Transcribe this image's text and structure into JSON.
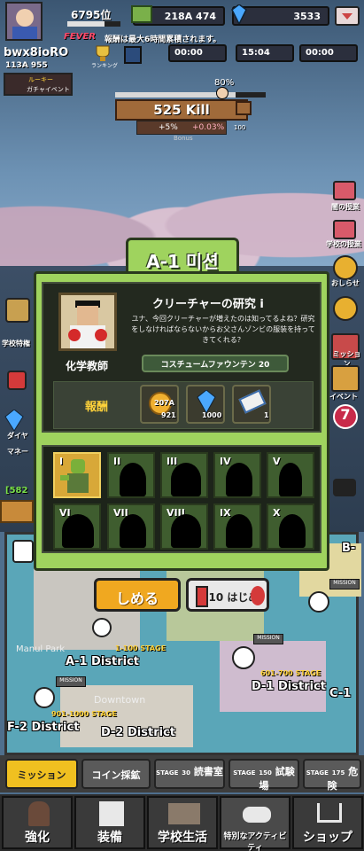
{
  "player": {
    "rank": "6795位",
    "name": "bwx8ioRO",
    "power": "113A 955",
    "banner_line1": "ルーキー",
    "banner_line2": "ガチャイベント"
  },
  "resources": {
    "cash": "218A 474",
    "gems": "3533"
  },
  "fever": {
    "label": "FEVER",
    "notice": "報酬は最大6時間累積されます。"
  },
  "timers": [
    "00:00",
    "15:04",
    "00:00"
  ],
  "icons_top": {
    "ranking": "ランキング"
  },
  "kill": {
    "percent": "80%",
    "count": "525 Kill",
    "bonus_plus": "+5%",
    "bonus_value": "+0.03%",
    "bonus_label": "Bonus",
    "side_value": "100"
  },
  "side_left": [
    "学校特権",
    "マネー",
    "ダイヤ"
  ],
  "side_right": [
    "闇の授業",
    "学校の授業",
    "おしらせ",
    "ミッション",
    "イベント"
  ],
  "side_left_counter": "[582",
  "side_right_badge": "7",
  "mission": {
    "header": "A-1 미션",
    "title": "クリーチャーの研究 i",
    "description": "ユナ、今回クリーチャーが増えたのは知ってるよね？研究をしなければならないからお父さんゾンビの服装を持ってきてくれる？",
    "npc_name": "化学教師",
    "requirement": "コスチュームファウンテン 20",
    "reward_label": "報酬",
    "rewards": [
      {
        "icon": "gold-coin-icon",
        "amount_top": "207A",
        "amount_bottom": "921"
      },
      {
        "icon": "diamond-icon",
        "amount": "1000"
      },
      {
        "icon": "ticket-icon",
        "amount": "1"
      }
    ],
    "slots": [
      "I",
      "II",
      "III",
      "IV",
      "V",
      "VI",
      "VII",
      "VIII",
      "IX",
      "X"
    ]
  },
  "buttons": {
    "close": "しめる",
    "start": "10 はじめ"
  },
  "map": {
    "district_a1": "A-1 District",
    "district_d1": "D-1 District",
    "district_c1": "C-1",
    "district_d2": "D-2 District",
    "district_f2": "F-2 District",
    "district_b1": "B-",
    "place_manulpark": "Manul Park",
    "place_downtown": "Downtown",
    "stage_1_100": "1-100 STAGE",
    "stage_601_700": "601-700 STAGE",
    "stage_901_1000": "901-1000 STAGE",
    "mission_sign": "MISSION"
  },
  "subnav": [
    {
      "label": "ミッション"
    },
    {
      "label": "コイン採鉱"
    },
    {
      "stage_label": "STAGE",
      "stage_num": "30",
      "label": "読書室"
    },
    {
      "stage_label": "STAGE",
      "stage_num": "150",
      "label": "試験場"
    },
    {
      "stage_label": "STAGE",
      "stage_num": "175",
      "label": "危険"
    }
  ],
  "nav": [
    "強化",
    "装備",
    "学校生活",
    "特別なアクティビティ",
    "ショップ"
  ]
}
